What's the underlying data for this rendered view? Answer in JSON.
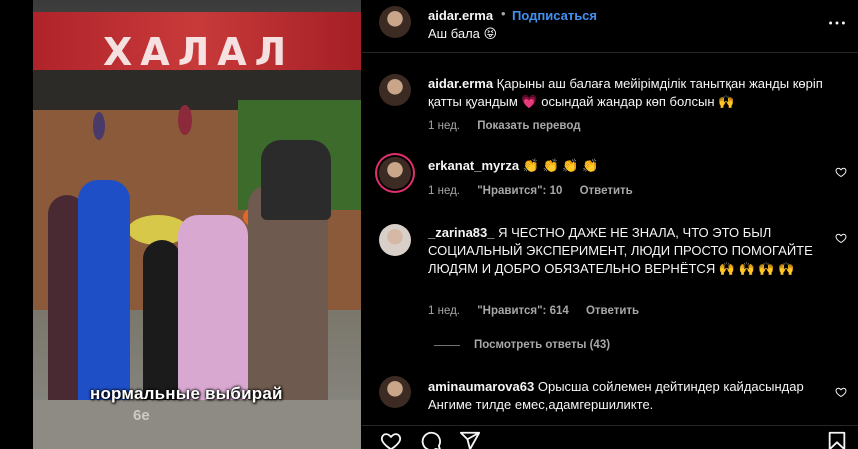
{
  "video": {
    "sign_text": "ХАЛАЛ",
    "subtitle": "нормальные выбирай",
    "subtitle_sub": "6е"
  },
  "post": {
    "author": "aidar.erma",
    "follow_label": "Подписаться",
    "caption": "Аш бала 😝"
  },
  "comments": [
    {
      "username": "aidar.erma",
      "text": "Қарыны аш балаға мейірімділік танытқан жанды көріп қатты қуандым 💗 осындай жандар көп болсын 🙌",
      "time": "1 нед.",
      "action": "Показать перевод"
    },
    {
      "username": "erkanat_myrza",
      "text": "👏 👏 👏 👏",
      "time": "1 нед.",
      "likes": "\"Нравится\": 10",
      "reply": "Ответить"
    },
    {
      "username": "_zarina83_",
      "text": "Я ЧЕСТНО ДАЖЕ НЕ ЗНАЛА, ЧТО ЭТО БЫЛ СОЦИАЛЬНЫЙ ЭКСПЕРИМЕНТ, ЛЮДИ ПРОСТО ПОМОГАЙТЕ ЛЮДЯМ И ДОБРО ОБЯЗАТЕЛЬНО ВЕРНЁТСЯ 🙌 🙌 🙌 🙌",
      "time": "1 нед.",
      "likes": "\"Нравится\": 614",
      "reply": "Ответить",
      "view_replies": "Посмотреть ответы (43)"
    },
    {
      "username": "aminaumarova63",
      "text": "Орысша сойлемен дейтиндер кайдасындар Ангиме тилде емес,адамгершиликте."
    }
  ],
  "icons": {
    "more": "more-horizontal-icon",
    "like": "heart-icon",
    "comment": "comment-icon",
    "share": "send-icon",
    "save": "bookmark-icon"
  },
  "colors": {
    "accent": "#4191f2",
    "muted": "#a8a8a8",
    "background": "#000000",
    "story_ring": "#e1306c"
  }
}
